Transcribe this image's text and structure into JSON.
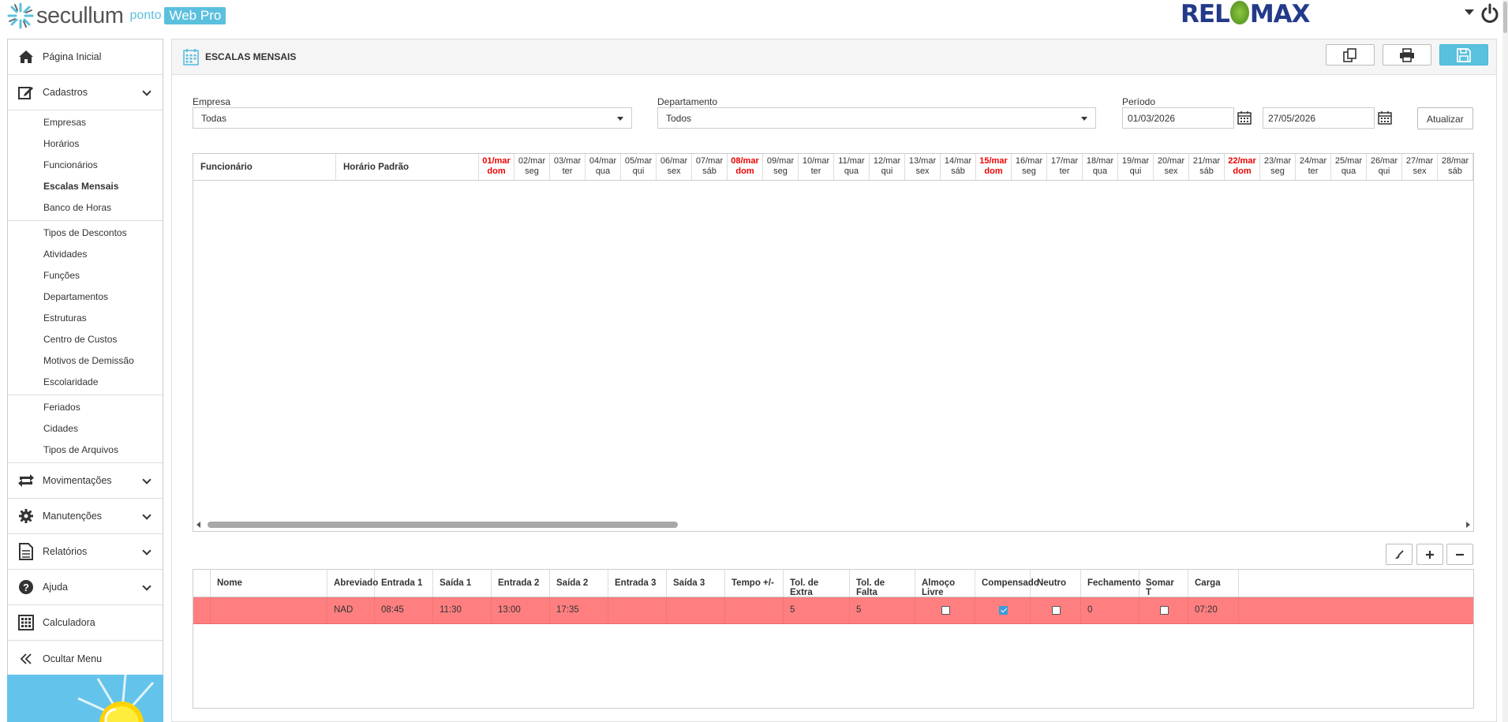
{
  "app": {
    "brand": "secullum",
    "product": "ponto",
    "edition": "Web Pro",
    "partner": "RELOMAX",
    "partner_left": "REL",
    "partner_right": "MAX"
  },
  "sidebar": {
    "home": "Página Inicial",
    "cadastros": "Cadastros",
    "groups": [
      [
        "Empresas",
        "Horários",
        "Funcionários",
        "Escalas Mensais",
        "Banco de Horas"
      ],
      [
        "Tipos de Descontos",
        "Atividades",
        "Funções",
        "Departamentos",
        "Estruturas",
        "Centro de Custos",
        "Motivos de Demissão",
        "Escolaridade"
      ],
      [
        "Feriados",
        "Cidades",
        "Tipos de Arquivos"
      ]
    ],
    "active": "Escalas Mensais",
    "movimentacoes": "Movimentações",
    "manutencoes": "Manutenções",
    "relatorios": "Relatórios",
    "ajuda": "Ajuda",
    "calculadora": "Calculadora",
    "ocultar": "Ocultar Menu"
  },
  "panel": {
    "title": "ESCALAS MENSAIS"
  },
  "filters": {
    "empresa_label": "Empresa",
    "empresa_value": "Todas",
    "departamento_label": "Departamento",
    "departamento_value": "Todos",
    "periodo_label": "Período",
    "periodo_start": "01/03/2026",
    "periodo_end": "27/05/2026",
    "atualizar": "Atualizar"
  },
  "schedule_grid": {
    "col_funcionario": "Funcionário",
    "col_horario": "Horário Padrão",
    "days": [
      {
        "d": "01/mar",
        "w": "dom",
        "sun": true
      },
      {
        "d": "02/mar",
        "w": "seg"
      },
      {
        "d": "03/mar",
        "w": "ter"
      },
      {
        "d": "04/mar",
        "w": "qua"
      },
      {
        "d": "05/mar",
        "w": "qui"
      },
      {
        "d": "06/mar",
        "w": "sex"
      },
      {
        "d": "07/mar",
        "w": "sáb"
      },
      {
        "d": "08/mar",
        "w": "dom",
        "sun": true
      },
      {
        "d": "09/mar",
        "w": "seg"
      },
      {
        "d": "10/mar",
        "w": "ter"
      },
      {
        "d": "11/mar",
        "w": "qua"
      },
      {
        "d": "12/mar",
        "w": "qui"
      },
      {
        "d": "13/mar",
        "w": "sex"
      },
      {
        "d": "14/mar",
        "w": "sáb"
      },
      {
        "d": "15/mar",
        "w": "dom",
        "sun": true
      },
      {
        "d": "16/mar",
        "w": "seg"
      },
      {
        "d": "17/mar",
        "w": "ter"
      },
      {
        "d": "18/mar",
        "w": "qua"
      },
      {
        "d": "19/mar",
        "w": "qui"
      },
      {
        "d": "20/mar",
        "w": "sex"
      },
      {
        "d": "21/mar",
        "w": "sáb"
      },
      {
        "d": "22/mar",
        "w": "dom",
        "sun": true
      },
      {
        "d": "23/mar",
        "w": "seg"
      },
      {
        "d": "24/mar",
        "w": "ter"
      },
      {
        "d": "25/mar",
        "w": "qua"
      },
      {
        "d": "26/mar",
        "w": "qui"
      },
      {
        "d": "27/mar",
        "w": "sex"
      },
      {
        "d": "28/mar",
        "w": "sáb"
      }
    ]
  },
  "schedule_table": {
    "headers": [
      "",
      "Nome",
      "Abreviado",
      "Entrada 1",
      "Saída 1",
      "Entrada 2",
      "Saída 2",
      "Entrada 3",
      "Saída 3",
      "Tempo +/-",
      "Tol. de Extra",
      "Tol. de Falta",
      "Almoço Livre",
      "Compensado",
      "Neutro",
      "Fechamento",
      "Somar T",
      "Carga"
    ],
    "row": {
      "nome": "",
      "abreviado": "NAD",
      "entrada1": "08:45",
      "saida1": "11:30",
      "entrada2": "13:00",
      "saida2": "17:35",
      "entrada3": "",
      "saida3": "",
      "tempo": "",
      "tol_extra": "5",
      "tol_falta": "5",
      "almoco_livre": false,
      "compensado": true,
      "neutro": false,
      "fechamento": "0",
      "somar_t": false,
      "carga": "07:20"
    }
  },
  "colors": {
    "accent": "#5bc0de",
    "sunday": "#e00000",
    "row_highlight": "#ff7f80"
  }
}
